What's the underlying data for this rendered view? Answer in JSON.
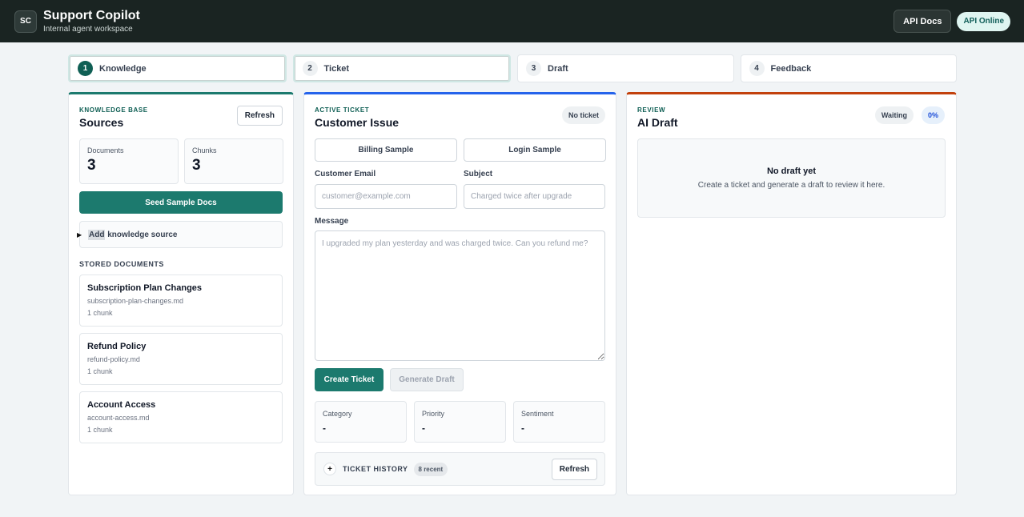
{
  "header": {
    "logo_text": "SC",
    "title": "Support Copilot",
    "subtitle": "Internal agent workspace",
    "api_docs_label": "API Docs",
    "api_status_label": "API Online"
  },
  "steps": [
    {
      "num": "1",
      "label": "Knowledge"
    },
    {
      "num": "2",
      "label": "Ticket"
    },
    {
      "num": "3",
      "label": "Draft"
    },
    {
      "num": "4",
      "label": "Feedback"
    }
  ],
  "knowledge": {
    "eyebrow": "KNOWLEDGE BASE",
    "title": "Sources",
    "refresh_label": "Refresh",
    "documents_label": "Documents",
    "documents_count": "3",
    "chunks_label": "Chunks",
    "chunks_count": "3",
    "seed_label": "Seed Sample Docs",
    "add_source_highlight": "Add",
    "add_source_rest": " knowledge source",
    "stored_label": "STORED DOCUMENTS",
    "docs": [
      {
        "title": "Subscription Plan Changes",
        "file": "subscription-plan-changes.md",
        "chunks": "1 chunk"
      },
      {
        "title": "Refund Policy",
        "file": "refund-policy.md",
        "chunks": "1 chunk"
      },
      {
        "title": "Account Access",
        "file": "account-access.md",
        "chunks": "1 chunk"
      }
    ]
  },
  "ticket": {
    "eyebrow": "ACTIVE TICKET",
    "title": "Customer Issue",
    "status_badge": "No ticket",
    "billing_sample_label": "Billing Sample",
    "login_sample_label": "Login Sample",
    "email_label": "Customer Email",
    "email_placeholder": "customer@example.com",
    "subject_label": "Subject",
    "subject_placeholder": "Charged twice after upgrade",
    "message_label": "Message",
    "message_placeholder": "I upgraded my plan yesterday and was charged twice. Can you refund me?",
    "create_label": "Create Ticket",
    "generate_label": "Generate Draft",
    "category_label": "Category",
    "category_value": "-",
    "priority_label": "Priority",
    "priority_value": "-",
    "sentiment_label": "Sentiment",
    "sentiment_value": "-",
    "history_toggle": "+",
    "history_label": "TICKET HISTORY",
    "history_count": "8 recent",
    "history_refresh_label": "Refresh"
  },
  "review": {
    "eyebrow": "REVIEW",
    "title": "AI Draft",
    "status_label": "Waiting",
    "confidence_label": "0%",
    "empty_title": "No draft yet",
    "empty_text": "Create a ticket and generate a draft to review it here."
  },
  "colors": {
    "brand_green": "#1c7a6e",
    "header_bg": "#1a2422",
    "ticket_accent": "#2563eb",
    "review_accent": "#c2410c"
  }
}
